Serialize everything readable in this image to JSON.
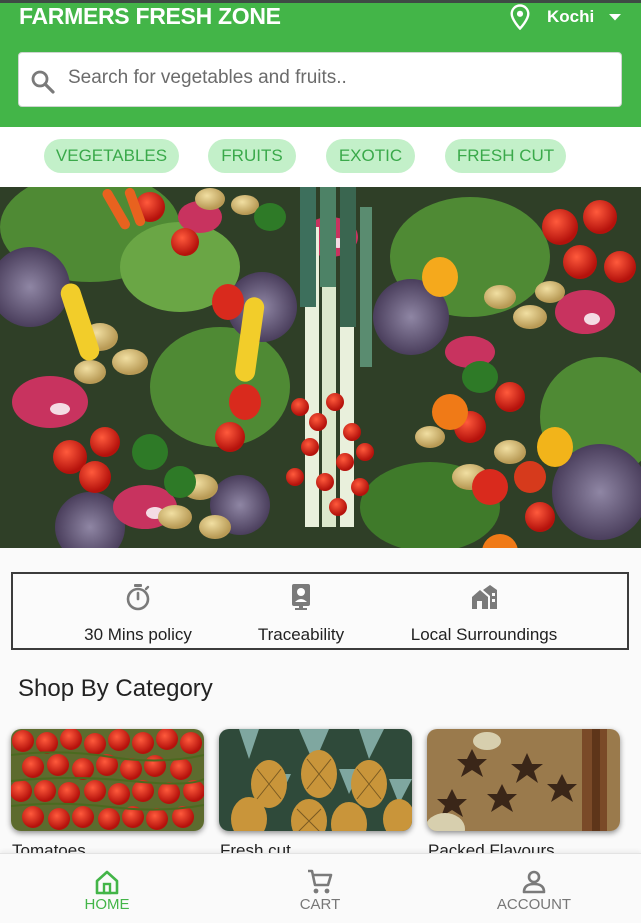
{
  "header": {
    "brand": "FARMERS FRESH ZONE",
    "location": "Kochi",
    "location_icon": "map-pin-icon",
    "dropdown_icon": "caret-down-icon",
    "brand_color": "#43b548"
  },
  "search": {
    "placeholder": "Search for vegetables and fruits..",
    "value": "",
    "icon": "search-icon"
  },
  "chips": [
    {
      "label": "VEGETABLES"
    },
    {
      "label": "FRUITS"
    },
    {
      "label": "EXOTIC"
    },
    {
      "label": "FRESH CUT"
    }
  ],
  "banner": {
    "description_icon": "vegetables-banner-image"
  },
  "features": [
    {
      "label": "30 Mins policy",
      "icon": "stopwatch-icon"
    },
    {
      "label": "Traceability",
      "icon": "camera-badge-icon"
    },
    {
      "label": "Local Surroundings",
      "icon": "homes-icon"
    }
  ],
  "shop": {
    "title": "Shop By Category",
    "categories": [
      {
        "label": "Tomatoes",
        "image": "tomatoes-image"
      },
      {
        "label": "Fresh cut",
        "image": "pineapples-image"
      },
      {
        "label": "Packed Flavours",
        "image": "spices-image"
      }
    ]
  },
  "bottom_nav": [
    {
      "label": "HOME",
      "icon": "home-icon",
      "active": true
    },
    {
      "label": "CART",
      "icon": "cart-icon",
      "active": false
    },
    {
      "label": "ACCOUNT",
      "icon": "account-icon",
      "active": false
    }
  ],
  "colors": {
    "accent": "#43b548",
    "chip_bg": "#c3f0c9",
    "chip_text": "#3aa94a",
    "icon_gray": "#7a7a7a"
  }
}
